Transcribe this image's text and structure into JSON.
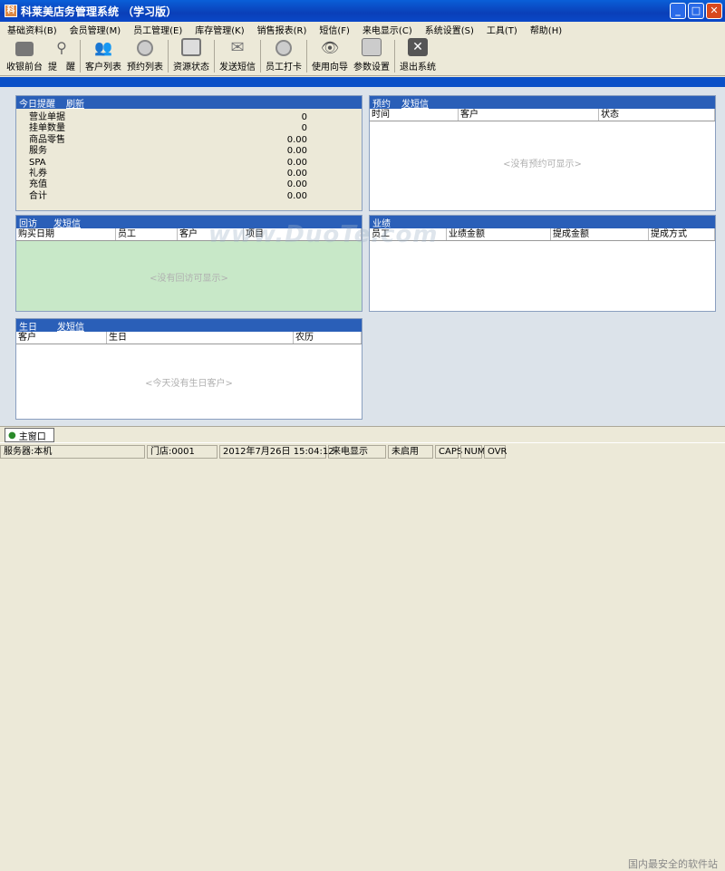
{
  "window": {
    "title": "科莱美店务管理系统 （学习版）"
  },
  "menu": [
    "基础资料(B)",
    "会员管理(M)",
    "员工管理(E)",
    "库存管理(K)",
    "销售报表(R)",
    "短信(F)",
    "来电显示(C)",
    "系统设置(S)",
    "工具(T)",
    "帮助(H)"
  ],
  "toolbar": [
    {
      "label": "收银前台",
      "icon": "cash-register-icon"
    },
    {
      "label": "提　醒",
      "icon": "reminder-icon"
    },
    {
      "label": "客户列表",
      "icon": "customers-icon"
    },
    {
      "label": "预约列表",
      "icon": "appointment-icon"
    },
    {
      "label": "资源状态",
      "icon": "resource-icon"
    },
    {
      "label": "发送短信",
      "icon": "envelope-icon"
    },
    {
      "label": "员工打卡",
      "icon": "clock-in-icon"
    },
    {
      "label": "使用向导",
      "icon": "eye-icon"
    },
    {
      "label": "参数设置",
      "icon": "settings-icon"
    },
    {
      "label": "退出系统",
      "icon": "exit-icon"
    }
  ],
  "today": {
    "title": "今日提醒",
    "link": "刷新",
    "rows": [
      {
        "label": "营业单据",
        "value": "0"
      },
      {
        "label": "挂单数量",
        "value": "0"
      },
      {
        "label": "商品零售",
        "value": "0.00"
      },
      {
        "label": "服务",
        "value": "0.00"
      },
      {
        "label": "SPA",
        "value": "0.00"
      },
      {
        "label": "礼券",
        "value": "0.00"
      },
      {
        "label": "充值",
        "value": "0.00"
      },
      {
        "label": "合计",
        "value": "0.00"
      }
    ]
  },
  "booking": {
    "title": "预约",
    "link": "发短信",
    "cols": [
      "时间",
      "客户",
      "状态"
    ],
    "empty": "<没有预约可显示>"
  },
  "visit": {
    "title": "回访",
    "link": "发短信",
    "cols": [
      "购买日期",
      "员工",
      "客户",
      "项目"
    ],
    "empty": "<没有回访可显示>"
  },
  "perf": {
    "title": "业绩",
    "cols": [
      "员工",
      "业绩金额",
      "提成金额",
      "提成方式"
    ]
  },
  "birthday": {
    "title": "生日",
    "link": "发短信",
    "cols": [
      "客户",
      "生日",
      "农历"
    ],
    "empty": "<今天没有生日客户>"
  },
  "tab": "主窗口",
  "status": [
    "服务器:本机",
    "门店:0001",
    "2012年7月26日  15:04:12",
    "来电显示",
    "未启用",
    "CAPS",
    "NUM",
    "OVR"
  ],
  "watermark": "www.DuoTe.com",
  "watermark2": "国内最安全的软件站"
}
